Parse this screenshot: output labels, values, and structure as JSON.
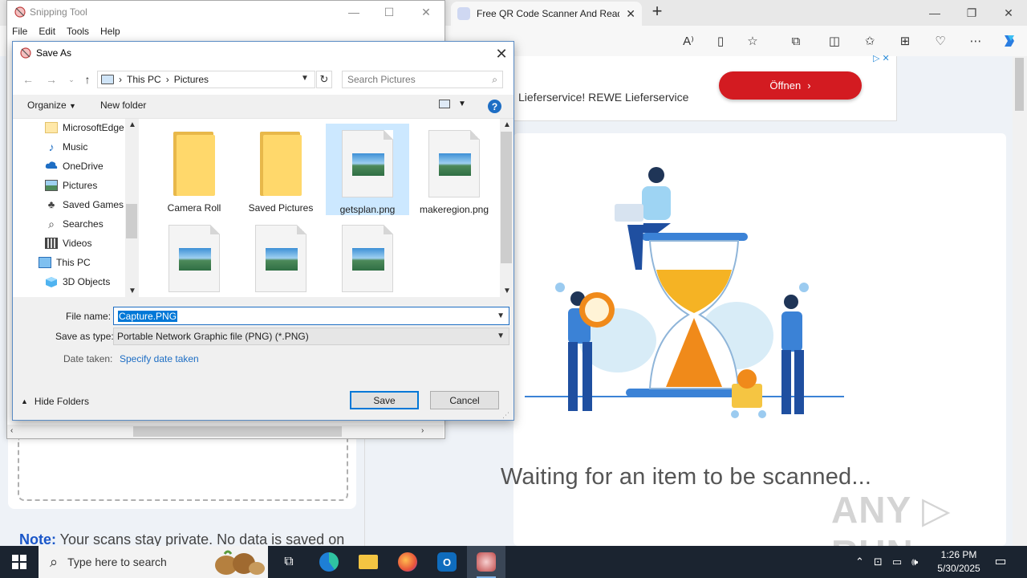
{
  "browser": {
    "tab_title": "Free QR Code Scanner And Read",
    "new_tab": "+",
    "minimize": "—",
    "restore": "❐",
    "close": "✕",
    "toolbar_icons": [
      "read-aloud-icon",
      "immersive-reader-icon",
      "favorite-icon",
      "extensions-icon",
      "split-screen-icon",
      "favorites-icon",
      "collections-icon",
      "performance-icon",
      "more-icon",
      "copilot-icon"
    ]
  },
  "page": {
    "ad_text": "Lieferservice! REWE Lieferservice",
    "ad_button": "Öffnen",
    "waiting_text": "Waiting for an item to be scanned...",
    "watermark": "ANY ▷ RUN",
    "note_label": "Note:",
    "note_text": " Your scans stay private. No data is saved on"
  },
  "snipping_tool": {
    "title": "Snipping Tool",
    "menu": [
      "File",
      "Edit",
      "Tools",
      "Help"
    ]
  },
  "dialog": {
    "title": "Save As",
    "breadcrumb": [
      "This PC",
      "Pictures"
    ],
    "search_placeholder": "Search Pictures",
    "organize": "Organize",
    "new_folder": "New folder",
    "help": "?",
    "nav_items": [
      {
        "label": "MicrosoftEdge",
        "icon": "folder-icon"
      },
      {
        "label": "Music",
        "icon": "music-icon"
      },
      {
        "label": "OneDrive",
        "icon": "cloud-icon"
      },
      {
        "label": "Pictures",
        "icon": "pictures-icon"
      },
      {
        "label": "Saved Games",
        "icon": "games-icon"
      },
      {
        "label": "Searches",
        "icon": "search-icon"
      },
      {
        "label": "Videos",
        "icon": "videos-icon"
      },
      {
        "label": "This PC",
        "icon": "computer-icon"
      },
      {
        "label": "3D Objects",
        "icon": "cube-icon"
      }
    ],
    "files": [
      {
        "name": "Camera Roll",
        "type": "folder",
        "selected": false
      },
      {
        "name": "Saved Pictures",
        "type": "folder",
        "selected": false
      },
      {
        "name": "getsplan.png",
        "type": "image",
        "selected": true
      },
      {
        "name": "makeregion.png",
        "type": "image",
        "selected": false
      },
      {
        "name": "",
        "type": "image",
        "selected": false
      },
      {
        "name": "",
        "type": "image",
        "selected": false
      },
      {
        "name": "",
        "type": "image",
        "selected": false
      }
    ],
    "file_name_label": "File name:",
    "file_name_value": "Capture.PNG",
    "save_type_label": "Save as type:",
    "save_type_value": "Portable Network Graphic file (PNG) (*.PNG)",
    "date_taken_label": "Date taken:",
    "date_taken_link": "Specify date taken",
    "hide_folders": "Hide Folders",
    "save": "Save",
    "cancel": "Cancel"
  },
  "taskbar": {
    "search_placeholder": "Type here to search",
    "time": "1:26 PM",
    "date": "5/30/2025",
    "apps": [
      "task-view-icon",
      "edge-icon",
      "file-explorer-icon",
      "firefox-icon",
      "outlook-icon",
      "snipping-tool-icon"
    ]
  },
  "colors": {
    "accent": "#0078d7",
    "ad_button": "#d31b21",
    "taskbar": "#1b2430"
  }
}
